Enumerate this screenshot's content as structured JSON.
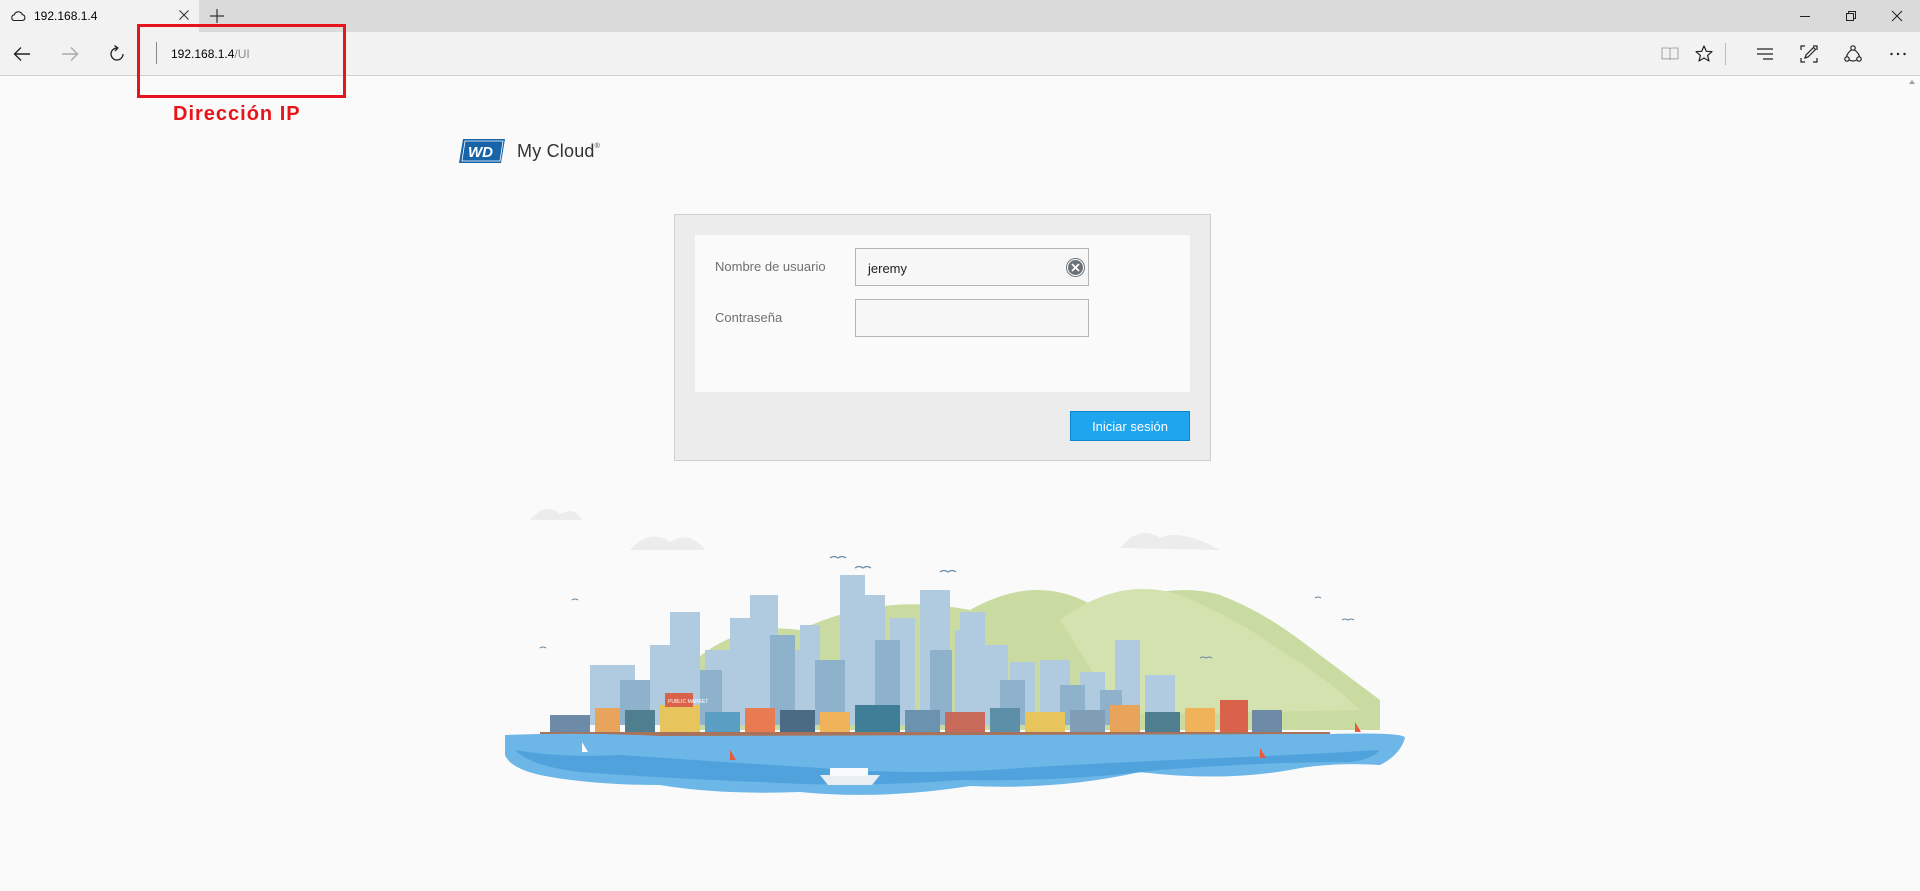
{
  "browser": {
    "tab_title": "192.168.1.4",
    "url_host": "192.168.1.4",
    "url_path": "/UI",
    "icons": {
      "favicon": "cloud-icon",
      "tab_close": "close-icon",
      "new_tab": "plus-icon",
      "back": "arrow-left-icon",
      "forward": "arrow-right-icon",
      "refresh": "refresh-icon",
      "reading_view": "book-icon",
      "favorites": "star-icon",
      "hub": "hub-icon",
      "web_note": "pen-note-icon",
      "share": "share-icon",
      "more": "more-icon",
      "minimize": "minimize-icon",
      "restore": "restore-icon",
      "close_window": "close-icon"
    }
  },
  "annotation": {
    "label": "Dirección IP",
    "color": "#e8141b"
  },
  "brand": {
    "badge_text": "WD",
    "product_name": "My Cloud",
    "trademark": "®",
    "badge_color": "#1764a8"
  },
  "login": {
    "username_label": "Nombre de usuario",
    "username_value": "jeremy",
    "password_label": "Contraseña",
    "password_value": "",
    "submit_label": "Iniciar sesión",
    "button_color": "#1ea5ee"
  },
  "illustration": {
    "market_sign": "PUBLIC MARKET"
  }
}
